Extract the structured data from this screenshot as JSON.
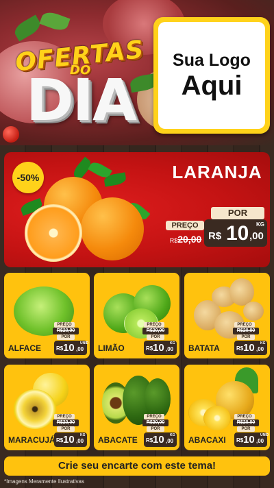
{
  "header": {
    "title_line1": "OFERTAS",
    "title_line2": "DO",
    "title_line3": "DIA",
    "logo_line1": "Sua Logo",
    "logo_line2": "Aqui"
  },
  "hero": {
    "discount": "-50%",
    "product": "LARANJA",
    "por_label": "POR",
    "preco_label": "PREÇO",
    "old_currency": "R$",
    "old_price": "20,00",
    "currency": "R$",
    "price_int": "10",
    "price_dec": ",00",
    "unit": "KG"
  },
  "products": [
    {
      "name": "ALFACE",
      "preco_label": "PREÇO",
      "old_price": "R$20,00",
      "por_label": "POR",
      "currency": "R$",
      "price_int": "10",
      "price_dec": ",00",
      "unit": "UNID"
    },
    {
      "name": "LIMÃO",
      "preco_label": "PREÇO",
      "old_price": "R$20,00",
      "por_label": "POR",
      "currency": "R$",
      "price_int": "10",
      "price_dec": ",00",
      "unit": "KG"
    },
    {
      "name": "BATATA",
      "preco_label": "PREÇO",
      "old_price": "R$20,00",
      "por_label": "POR",
      "currency": "R$",
      "price_int": "10",
      "price_dec": ",00",
      "unit": "KG"
    },
    {
      "name": "MARACUJÁ",
      "preco_label": "PREÇO",
      "old_price": "R$20,00",
      "por_label": "POR",
      "currency": "R$",
      "price_int": "10",
      "price_dec": ",00",
      "unit": "KG"
    },
    {
      "name": "ABACATE",
      "preco_label": "PREÇO",
      "old_price": "R$20,00",
      "por_label": "POR",
      "currency": "R$",
      "price_int": "10",
      "price_dec": ",00",
      "unit": "KG"
    },
    {
      "name": "ABACAXI",
      "preco_label": "PREÇO",
      "old_price": "R$20,00",
      "por_label": "POR",
      "currency": "R$",
      "price_int": "10",
      "price_dec": ",00",
      "unit": "UNID"
    }
  ],
  "footer": {
    "cta": "Crie seu encarte com este tema!",
    "disclaimer": "*Imagens Meramente Ilustrativas"
  },
  "colors": {
    "accent_yellow": "#ffc20e",
    "hero_red": "#c41313",
    "price_box": "#3a2a21",
    "wood_background": "#3a2a21"
  }
}
